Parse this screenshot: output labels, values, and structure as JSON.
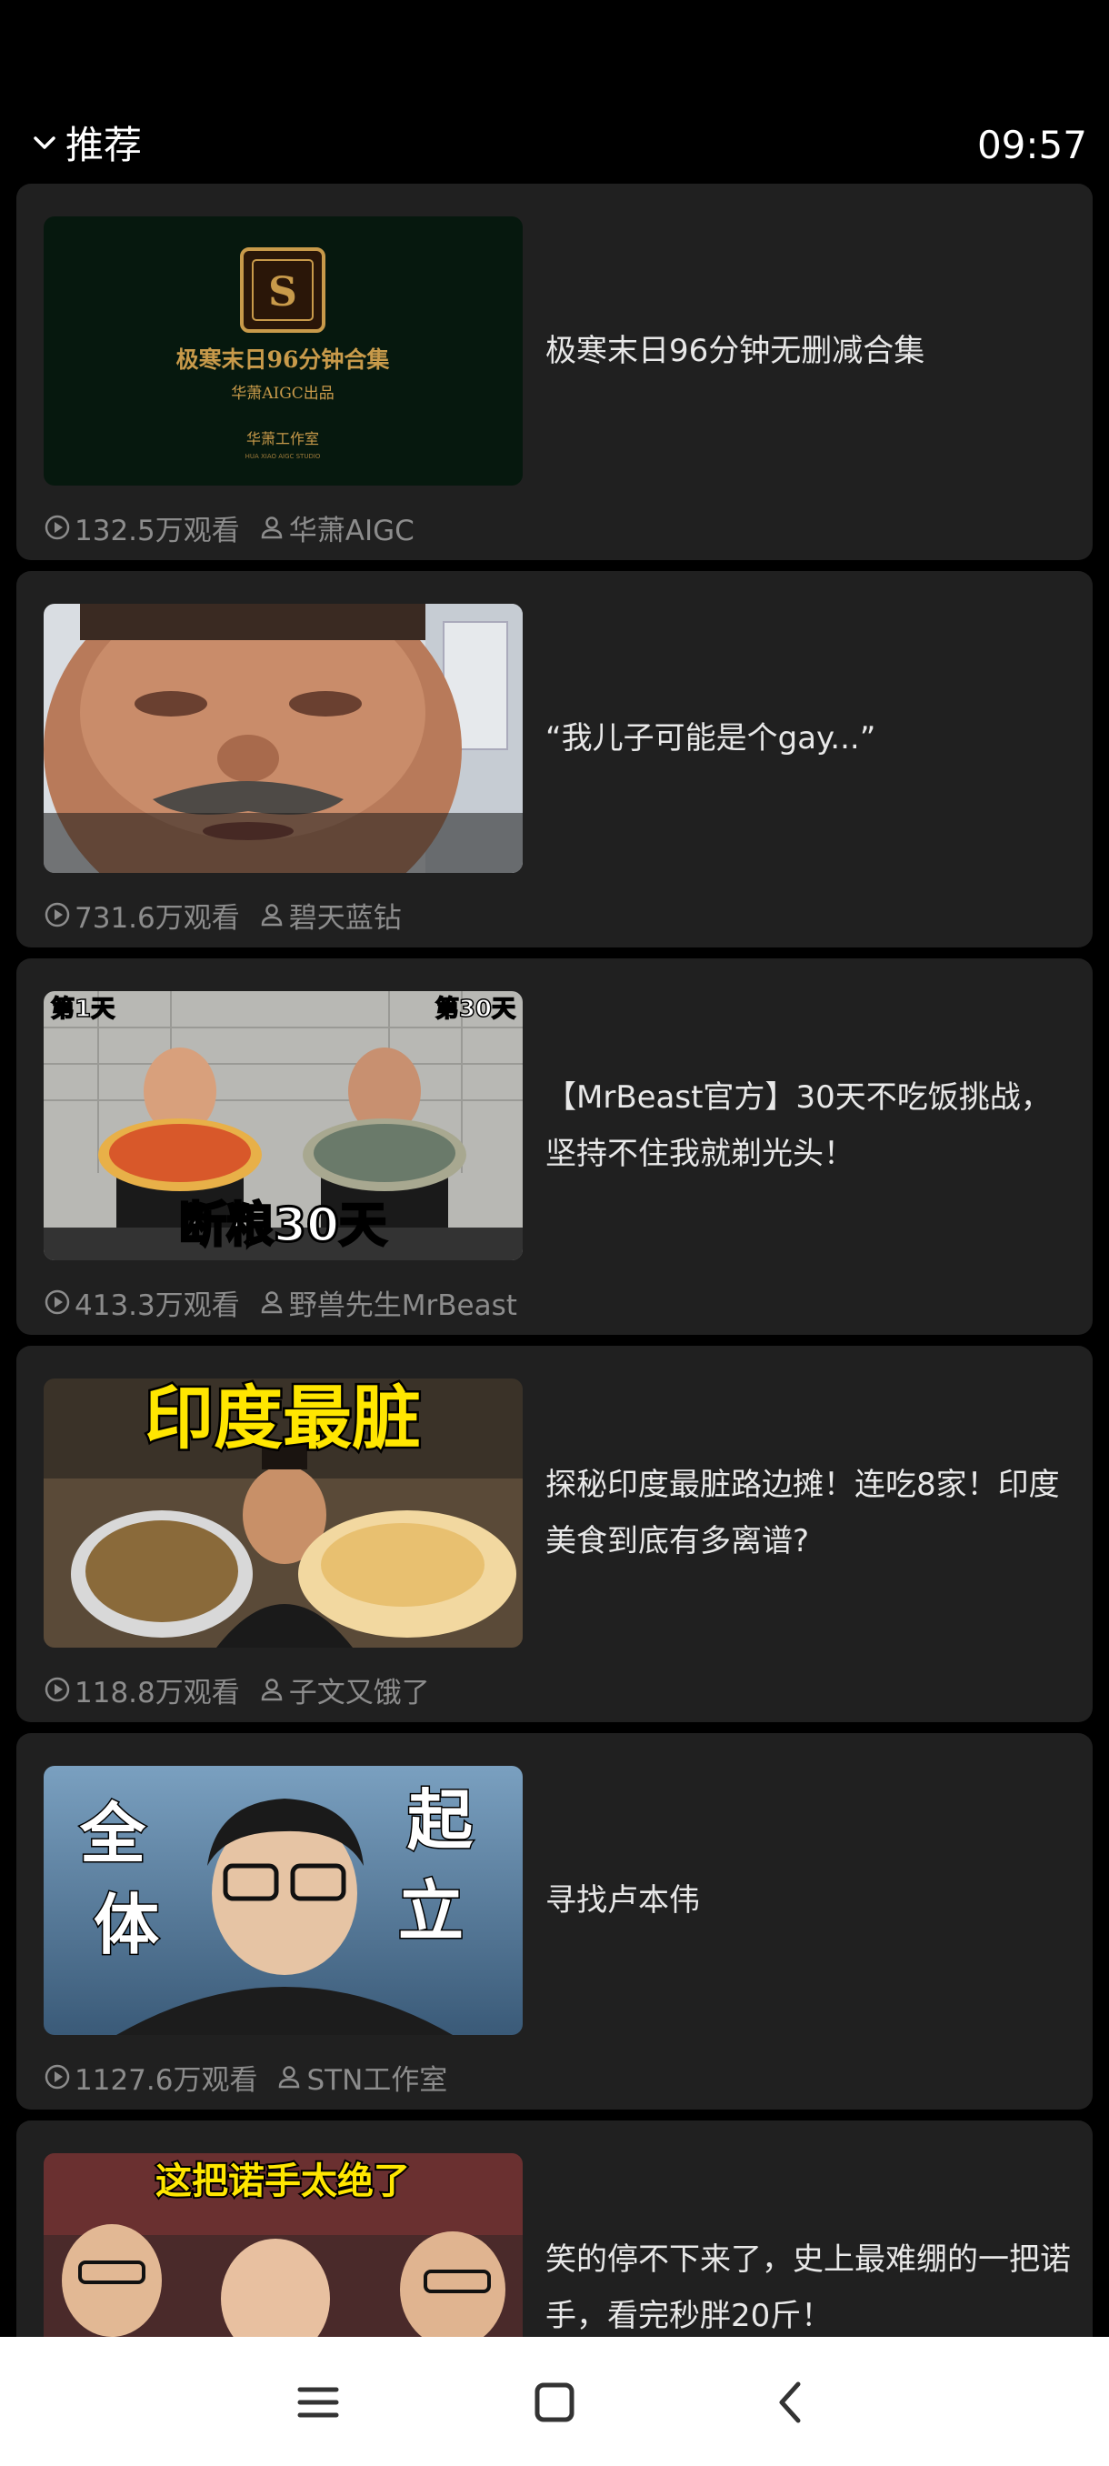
{
  "header": {
    "section": "推荐",
    "time": "09:57"
  },
  "videos": [
    {
      "title": "极寒末日96分钟无删减合集",
      "views": "132.5万观看",
      "author": "华萧AIGC",
      "thumb_text": {
        "main": "极寒末日96分钟合集",
        "sub": "华萧AIGC出品",
        "studio": "华萧工作室",
        "studio_en": "HUA XIAO AIGC STUDIO"
      }
    },
    {
      "title": "“我儿子可能是个gay...”",
      "views": "731.6万观看",
      "author": "碧天蓝钻"
    },
    {
      "title": "【MrBeast官方】30天不吃饭挑战，坚持不住我就剃光头！",
      "views": "413.3万观看",
      "author": "野兽先生MrBeast",
      "thumb_text": {
        "left": "第1天",
        "right": "第30天",
        "bottom": "断粮30天"
      }
    },
    {
      "title": "探秘印度最脏路边摊！连吃8家！印度美食到底有多离谱?",
      "views": "118.8万观看",
      "author": "子文又饿了",
      "thumb_text": {
        "top": "印度最脏"
      }
    },
    {
      "title": "寻找卢本伟",
      "views": "1127.6万观看",
      "author": "STN工作室",
      "thumb_text": {
        "c1": "全",
        "c2": "体",
        "c3": "起",
        "c4": "立"
      }
    },
    {
      "title": "笑的停不下来了，史上最难绷的一把诺手，看完秒胖20斤！",
      "thumb_text": {
        "top": "这把诺手太绝了"
      }
    }
  ],
  "icons": {
    "chevron": "chevron-down-icon",
    "views": "play-circle-icon",
    "author": "person-icon",
    "nav_menu": "menu-icon",
    "nav_home": "square-home-icon",
    "nav_back": "back-icon"
  },
  "colors": {
    "card_bg": "#202020",
    "meta": "#8c8c8c",
    "title": "#e8e8e8",
    "gold": "#c89a4a",
    "yellow": "#ffe600"
  }
}
